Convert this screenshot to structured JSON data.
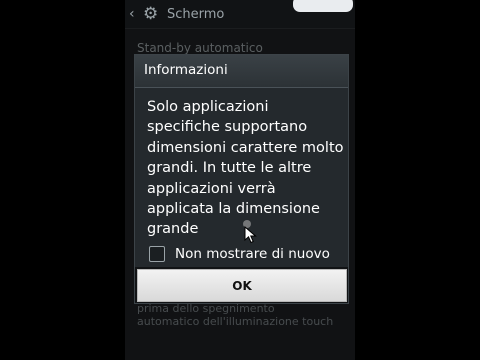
{
  "topbar": {
    "back_icon": "chevron-left-icon",
    "settings_icon": "gear-icon",
    "title": "Schermo"
  },
  "background": {
    "header_text": "Stand-by automatico",
    "footer_text": "prima dello spegnimento automatico dell'illuminazione touch"
  },
  "dialog": {
    "title": "Informazioni",
    "message": "Solo applicazioni specifiche supportano dimensioni carattere molto grandi. In tutte le altre applicazioni verrà applicata la dimensione grande",
    "checkbox_label": "Non mostrare di nuovo",
    "checkbox_checked": false,
    "ok_label": "OK"
  },
  "colors": {
    "dialog_bg": "#24292d",
    "button_bg": "#e6e6e6"
  }
}
